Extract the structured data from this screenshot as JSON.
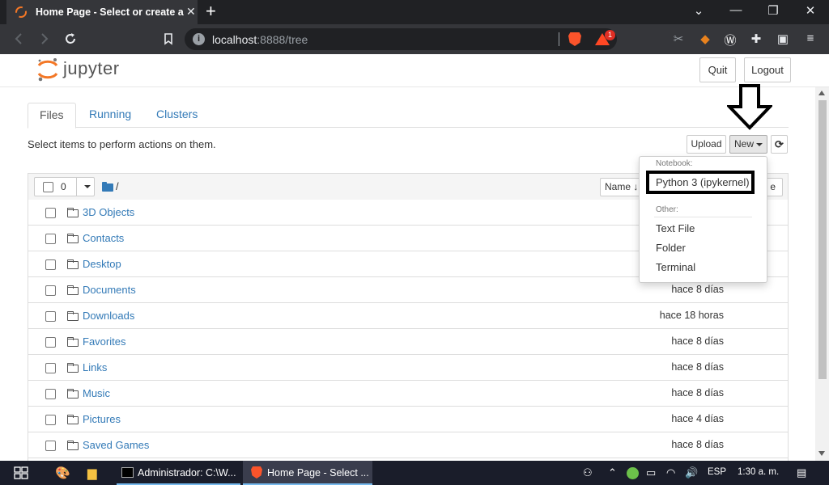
{
  "browser": {
    "tab_title": "Home Page - Select or create a no",
    "tab_close": "✕",
    "new_tab": "+",
    "url_host": "localhost",
    "url_rest": ":8888/tree",
    "bat_badge": "1",
    "window_controls": [
      "⌄",
      "—",
      "❐",
      "✕"
    ],
    "toolbar_icons": [
      "back-icon",
      "forward-icon",
      "reload-icon",
      "bookmark-icon"
    ]
  },
  "jupyter": {
    "logo_text": "jupyter",
    "quit_label": "Quit",
    "logout_label": "Logout"
  },
  "tabs": [
    {
      "label": "Files",
      "active": true
    },
    {
      "label": "Running",
      "active": false
    },
    {
      "label": "Clusters",
      "active": false
    }
  ],
  "actions": {
    "hint": "Select items to perform actions on them.",
    "upload_label": "Upload",
    "new_label": "New",
    "refresh_icon": "⟳"
  },
  "list": {
    "selected_count": "0",
    "breadcrumb": "/",
    "name_sort_label": "Name ↓",
    "hidden_button_fragment": "e",
    "items": [
      {
        "name": "3D Objects",
        "modified": ""
      },
      {
        "name": "Contacts",
        "modified": ""
      },
      {
        "name": "Desktop",
        "modified": ""
      },
      {
        "name": "Documents",
        "modified": "hace 8 días"
      },
      {
        "name": "Downloads",
        "modified": "hace 18 horas"
      },
      {
        "name": "Favorites",
        "modified": "hace 8 días"
      },
      {
        "name": "Links",
        "modified": "hace 8 días"
      },
      {
        "name": "Music",
        "modified": "hace 8 días"
      },
      {
        "name": "Pictures",
        "modified": "hace 4 días"
      },
      {
        "name": "Saved Games",
        "modified": "hace 8 días"
      }
    ]
  },
  "dropdown": {
    "notebook_header": "Notebook:",
    "python_kernel": "Python 3 (ipykernel)",
    "other_header": "Other:",
    "text_file": "Text File",
    "folder": "Folder",
    "terminal": "Terminal"
  },
  "taskbar": {
    "cmd_label": "Administrador: C:\\W...",
    "browser_label": "Home Page - Select ...",
    "language": "ESP",
    "time": "1:30 a. m."
  },
  "colors": {
    "accent_link": "#337ab7",
    "jupyter_orange": "#f37726",
    "brave_orange": "#fb542b",
    "taskbar_bg": "#1a1d2a"
  }
}
